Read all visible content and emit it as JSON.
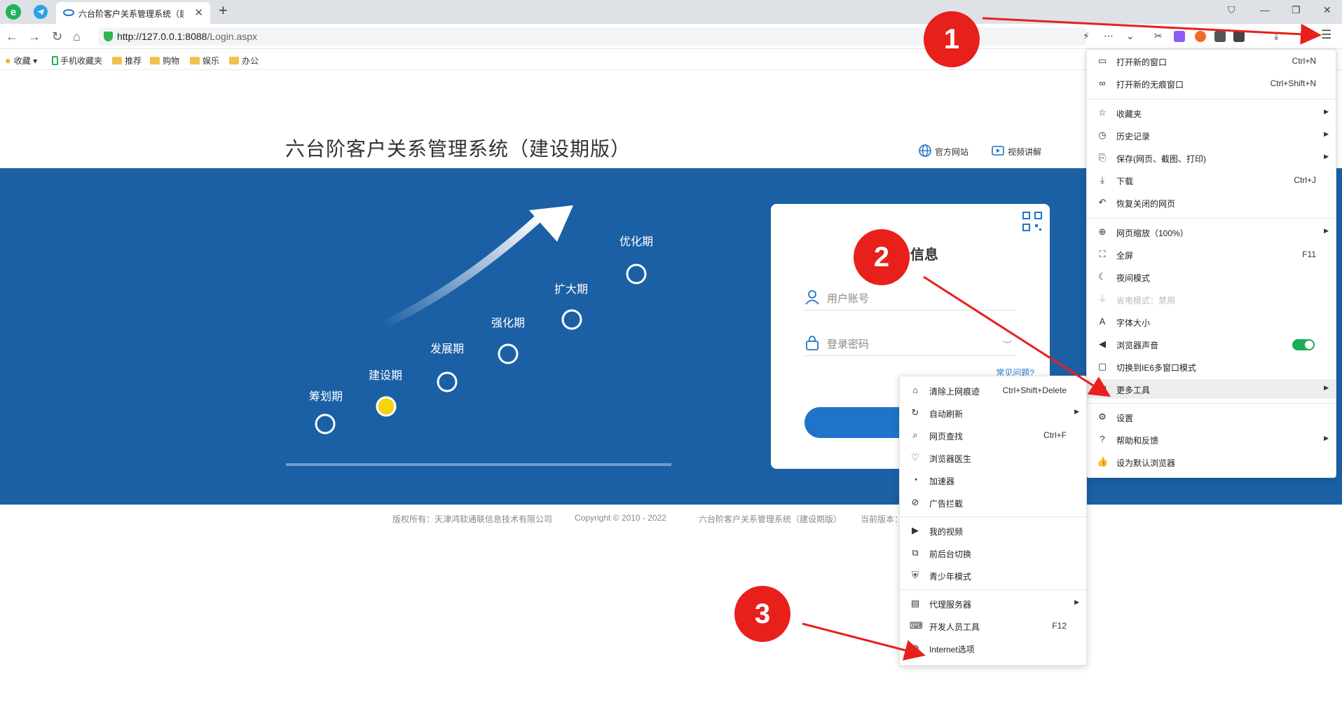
{
  "browser": {
    "tab_title": "六台阶客户关系管理系统（建",
    "url_host": "http://127.0.0.1:8088",
    "url_path": "/Login.aspx",
    "bookmarks": [
      {
        "label": "收藏",
        "kind": "star"
      },
      {
        "label": "手机收藏夹",
        "kind": "phone"
      },
      {
        "label": "推荐",
        "kind": "folder"
      },
      {
        "label": "购物",
        "kind": "folder"
      },
      {
        "label": "娱乐",
        "kind": "folder"
      },
      {
        "label": "办公",
        "kind": "folder"
      }
    ]
  },
  "page": {
    "title": "六台阶客户关系管理系统（建设期版）",
    "links": {
      "official": "官方网站",
      "video": "视频讲解"
    },
    "stages": [
      "筹划期",
      "建设期",
      "发展期",
      "强化期",
      "扩大期",
      "优化期"
    ],
    "active_stage": "建设期",
    "login": {
      "title": "登录信息",
      "username_placeholder": "用户账号",
      "password_placeholder": "登录密码",
      "faq": "常见问题?",
      "button": "登录"
    },
    "footer": {
      "owner": "版权所有：天津鸿软通联信息技术有限公司",
      "copyright": "Copyright © 2010 - 2022",
      "product": "六台阶客户关系管理系统（建设期版）",
      "version": "当前版本："
    }
  },
  "main_menu": {
    "items": [
      {
        "label": "打开新的窗口",
        "shortcut": "Ctrl+N",
        "icon": "window-icon"
      },
      {
        "label": "打开新的无痕窗口",
        "shortcut": "Ctrl+Shift+N",
        "icon": "incognito-icon"
      },
      {
        "label": "收藏夹",
        "arrow": true,
        "icon": "star-list-icon"
      },
      {
        "label": "历史记录",
        "arrow": true,
        "icon": "clock-icon"
      },
      {
        "label": "保存(网页、截图、打印)",
        "arrow": true,
        "icon": "save-icon"
      },
      {
        "label": "下载",
        "shortcut": "Ctrl+J",
        "icon": "download-icon"
      },
      {
        "label": "恢复关闭的网页",
        "icon": "undo-icon"
      },
      {
        "label": "网页缩放（100%）",
        "arrow": true,
        "icon": "zoom-icon"
      },
      {
        "label": "全屏",
        "shortcut": "F11",
        "icon": "fullscreen-icon"
      },
      {
        "label": "夜间模式",
        "icon": "moon-icon"
      },
      {
        "label": "省电模式：禁用",
        "disabled": true,
        "icon": "plug-icon"
      },
      {
        "label": "字体大小",
        "icon": "font-icon"
      },
      {
        "label": "浏览器声音",
        "toggle": true,
        "icon": "speaker-icon"
      },
      {
        "label": "切换到IE6多窗口模式",
        "icon": "ie-window-icon"
      },
      {
        "label": "更多工具",
        "arrow": true,
        "highlight": true,
        "icon": "toolbox-icon"
      },
      {
        "label": "设置",
        "icon": "gear-icon"
      },
      {
        "label": "帮助和反馈",
        "arrow": true,
        "icon": "help-icon"
      },
      {
        "label": "设为默认浏览器",
        "icon": "thumb-icon"
      }
    ]
  },
  "sub_menu": {
    "items": [
      {
        "label": "清除上网痕迹",
        "shortcut": "Ctrl+Shift+Delete",
        "icon": "broom-icon"
      },
      {
        "label": "自动刷新",
        "arrow": true,
        "icon": "refresh-icon"
      },
      {
        "label": "网页查找",
        "shortcut": "Ctrl+F",
        "icon": "find-icon"
      },
      {
        "label": "浏览器医生",
        "icon": "heart-icon"
      },
      {
        "label": "加速器",
        "icon": "speedometer-icon"
      },
      {
        "label": "广告拦截",
        "icon": "adblock-icon"
      },
      {
        "label": "我的视频",
        "icon": "video-icon"
      },
      {
        "label": "前后台切换",
        "icon": "switch-icon"
      },
      {
        "label": "青少年模式",
        "icon": "shield-icon"
      },
      {
        "label": "代理服务器",
        "arrow": true,
        "icon": "proxy-icon"
      },
      {
        "label": "开发人员工具",
        "shortcut": "F12",
        "icon": "code-icon"
      },
      {
        "label": "Internet选项",
        "icon": "globe-icon"
      }
    ]
  },
  "annotations": [
    "1",
    "2",
    "3"
  ]
}
